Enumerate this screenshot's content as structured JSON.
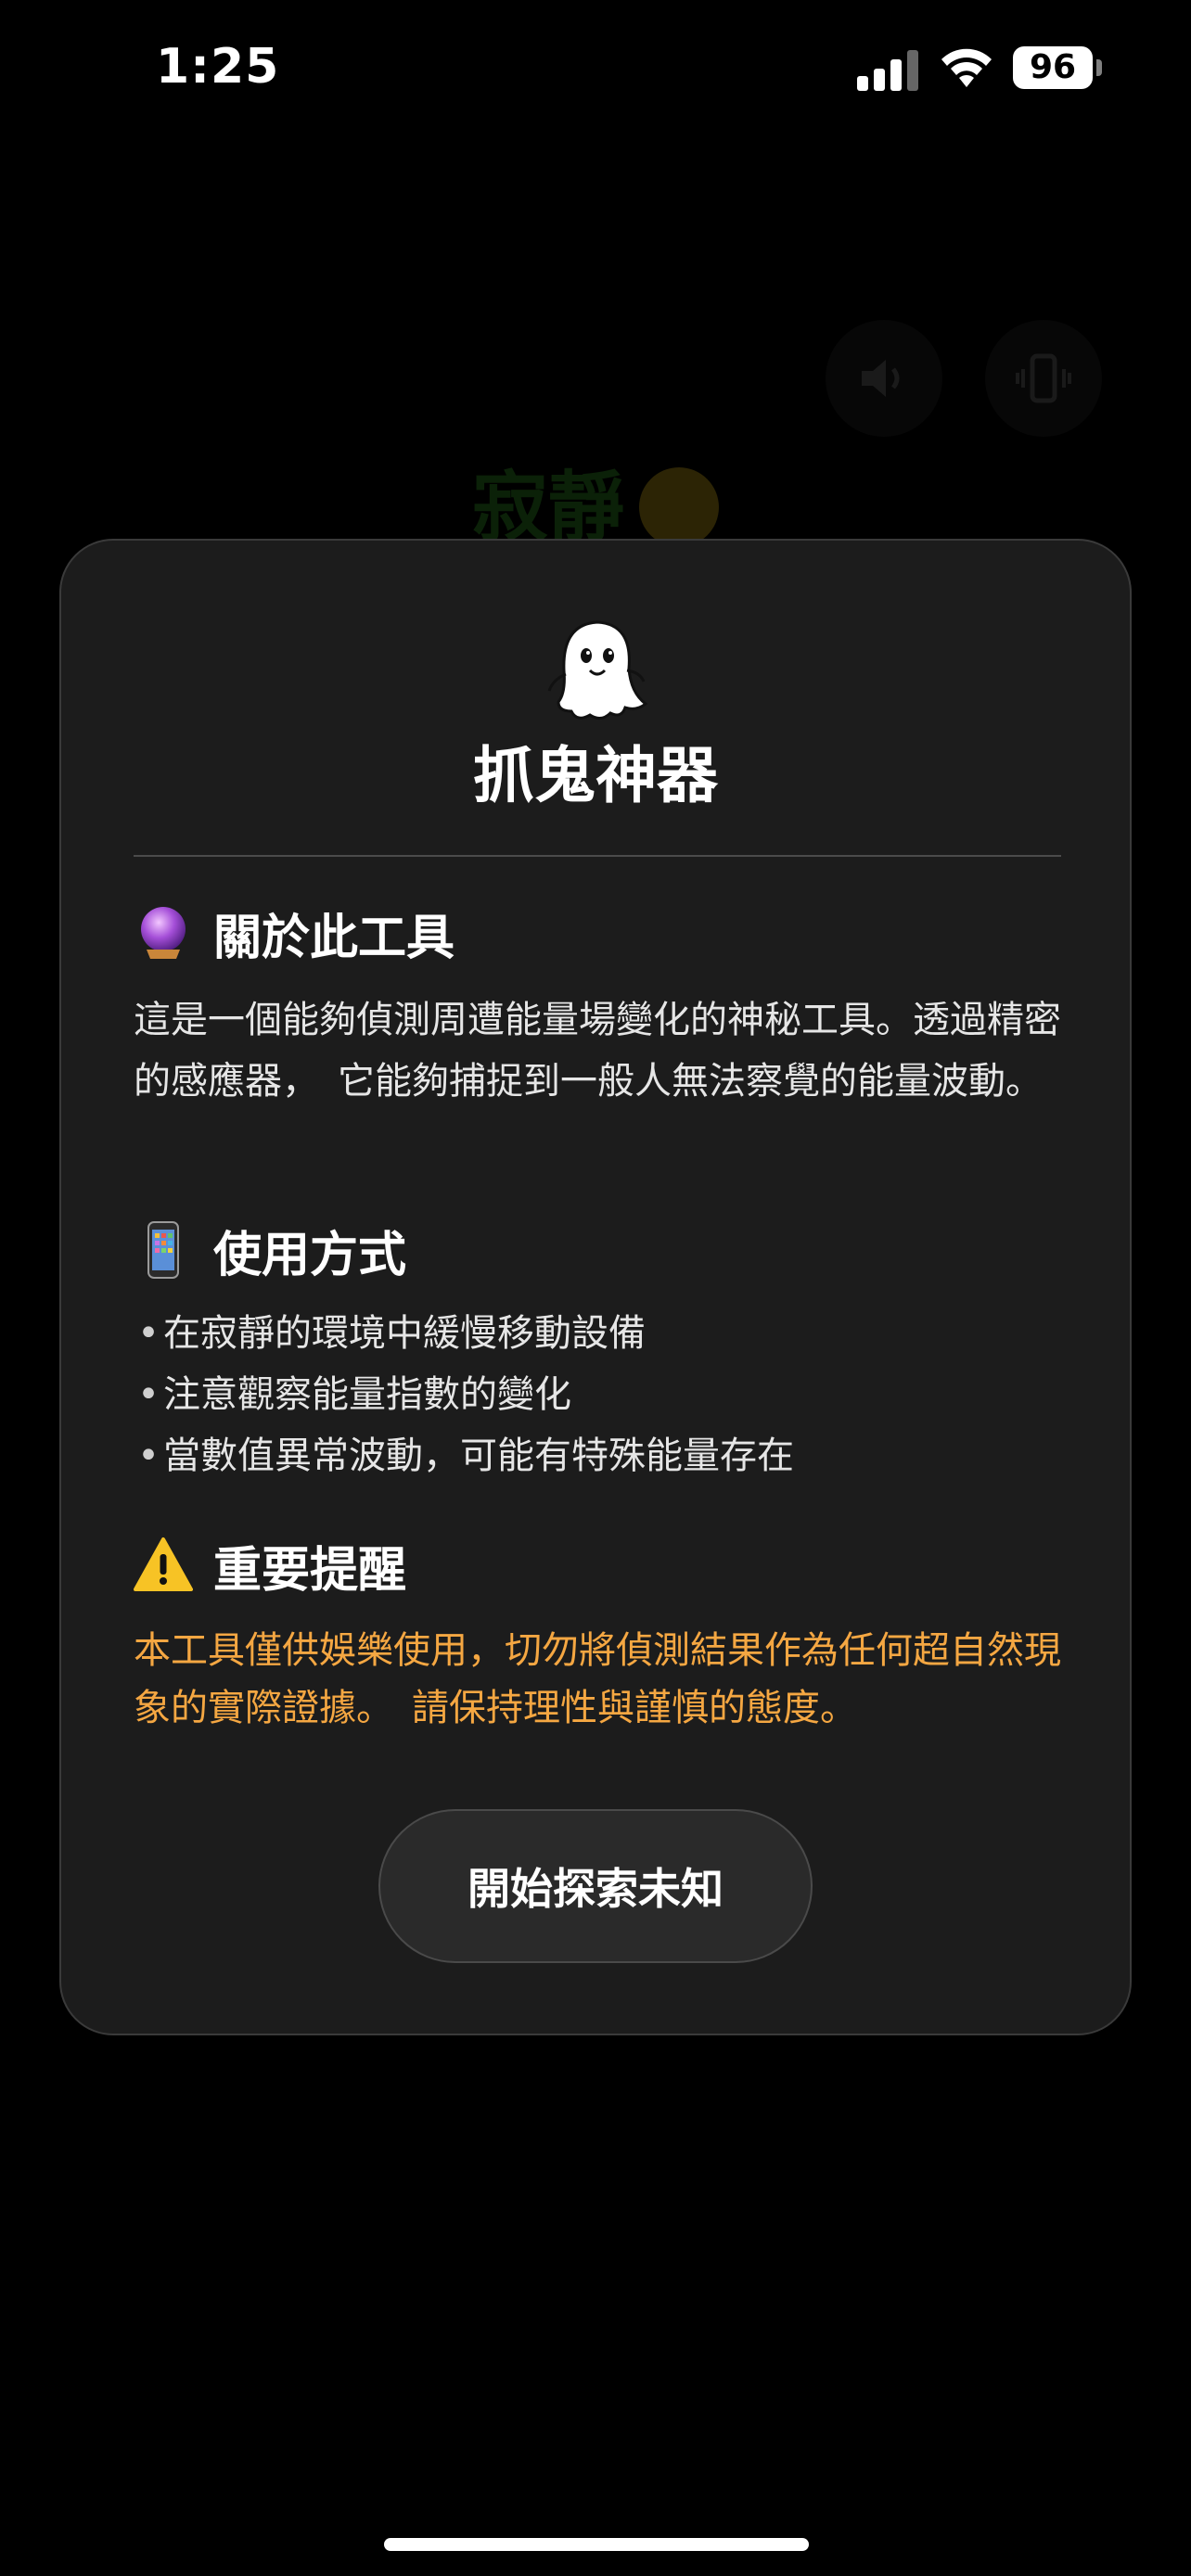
{
  "status_bar": {
    "time": "1:25",
    "battery": "96"
  },
  "background": {
    "status_text": "寂靜",
    "status_emoji": "smiling-face-with-sunglasses",
    "sound_button_icon": "speaker-icon",
    "vibrate_button_icon": "vibrate-icon"
  },
  "modal": {
    "icon": "ghost-icon",
    "title": "抓鬼神器",
    "about": {
      "icon": "crystal-ball-icon",
      "heading": "關於此工具",
      "body": "這是一個能夠偵測周遭能量場變化的神秘工具。透過精密的感應器，　它能夠捕捉到一般人無法察覺的能量波動。"
    },
    "usage": {
      "icon": "mobile-phone-icon",
      "heading": "使用方式",
      "bullet": "•",
      "items": [
        "在寂靜的環境中緩慢移動設備",
        "注意觀察能量指數的變化",
        "當數值異常波動，可能有特殊能量存在"
      ]
    },
    "warning": {
      "icon": "warning-icon",
      "heading": "重要提醒",
      "body": "本工具僅供娛樂使用，切勿將偵測結果作為任何超自然現象的實際證據。　請保持理性與謹慎的態度。"
    },
    "start_button": "開始探索未知"
  },
  "colors": {
    "background": "#000000",
    "card": "#1c1c1c",
    "card_border": "#3a3a3a",
    "warning_text": "#f5a742",
    "button": "#2a2a2a"
  }
}
